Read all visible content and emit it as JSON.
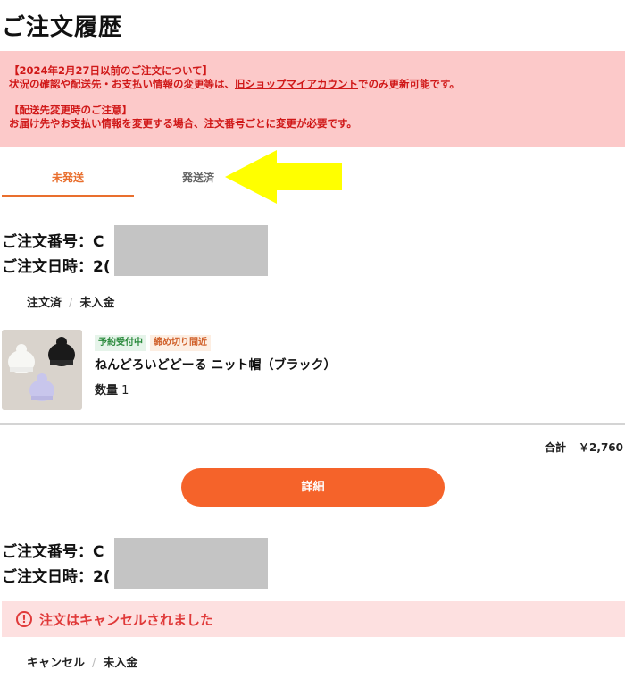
{
  "page": {
    "title": "ご注文履歴"
  },
  "notice": {
    "line1": "【2024年2月27日以前のご注文について】",
    "line2_before": "状況の確認や配送先・お支払い情報の変更等は、",
    "line2_link": "旧ショップマイアカウント",
    "line2_after": "でのみ更新可能です。",
    "line3": "【配送先変更時のご注意】",
    "line4": "お届け先やお支払い情報を変更する場合、注文番号ごとに変更が必要です。"
  },
  "tabs": [
    {
      "label": "未発送",
      "active": true
    },
    {
      "label": "発送済",
      "active": false
    }
  ],
  "annotation": {
    "arrow_color": "#ffff00"
  },
  "orders": [
    {
      "number_label": "ご注文番号：C",
      "date_label": "ご注文日時：2(",
      "order_status": "注文済",
      "payment_status": "未入金",
      "product": {
        "badges": [
          "予約受付中",
          "締め切り間近"
        ],
        "name": "ねんどろいどどーる ニット帽（ブラック）",
        "qty_label": "数量",
        "qty": "1",
        "image_icon": "knit-hats-product-image"
      },
      "total_label": "合計",
      "total_value": "￥2,760",
      "detail_button": "詳細"
    },
    {
      "number_label": "ご注文番号：C",
      "date_label": "ご注文日時：2(",
      "cancel_message": "注文はキャンセルされました",
      "cancel_icon": "alert-circle-icon",
      "order_status": "キャンセル",
      "payment_status": "未入金"
    }
  ],
  "colors": {
    "accent": "#f5632a",
    "tab_active": "#e96f2e",
    "notice_bg": "#fcc9c9",
    "notice_text": "#d01818",
    "cancel_bg": "#fde0e0",
    "cancel_text": "#e03a3a"
  }
}
